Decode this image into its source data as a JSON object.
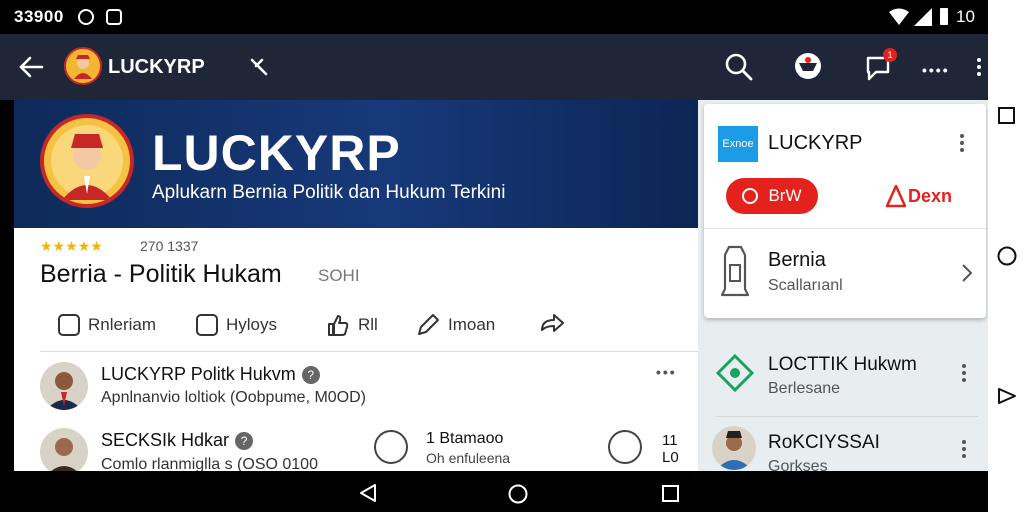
{
  "status_bar": {
    "time": "33900",
    "battery": "10"
  },
  "app_bar": {
    "title": "LUCKYRP",
    "notification_count": "1"
  },
  "banner": {
    "title": "LUCKYRP",
    "subtitle": "Aplukarn Bernia Politik dan Hukum Terkini"
  },
  "app": {
    "rating_stars": "★★★★★",
    "rating_count": "270 1337",
    "name": "Berria - Politik Hukam",
    "tag": "SOHI"
  },
  "actions": [
    {
      "label": "Rnleriam"
    },
    {
      "label": "Hyloys"
    },
    {
      "label": "Rll"
    },
    {
      "label": "Imoan"
    }
  ],
  "list": [
    {
      "title": "LUCKYRP Politk Hukvm",
      "subtitle": "Apnlnanvio loltiok (Oobpume, M0OD)"
    },
    {
      "title": "SECKSIk Hdkar",
      "subtitle": "Comlo rlanmiglla s (OSO 0100"
    }
  ],
  "list_extra": {
    "title": "1 Btamaoo",
    "subtitle": "Oh enfuleena",
    "right_value": "11 L0"
  },
  "right_panel": {
    "card": {
      "badge": "Exnoe",
      "title": "LUCKYRP",
      "primary_button": "BrW",
      "secondary_link": "Dexn",
      "item_title": "Bernia",
      "item_subtitle": "Scallarıanl"
    },
    "items": [
      {
        "title": "LOCTTIK Hukwm",
        "subtitle": "Berlesane"
      },
      {
        "title": "RoKCIYSSAI",
        "subtitle": "Gorkses"
      }
    ]
  },
  "colors": {
    "app_bar": "#1e2638",
    "banner": "#17397a",
    "accent_red": "#e4211c",
    "star": "#f4b400",
    "badge_blue": "#1c9be6"
  }
}
